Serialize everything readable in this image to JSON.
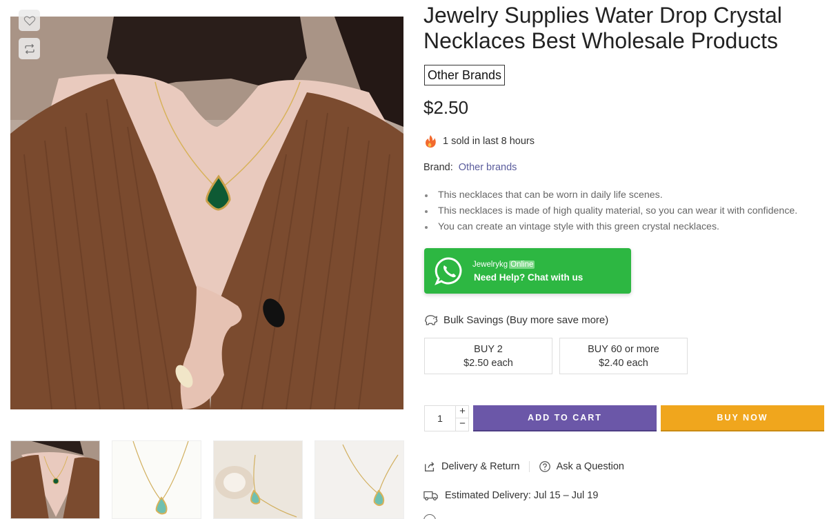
{
  "gallery": {
    "wishlist_icon": "heart-icon",
    "compare_icon": "compare-arrows-icon",
    "main_image_alt": "Model wearing green water drop crystal necklace with brown knit halter top",
    "thumbnails": [
      "thumb-1",
      "thumb-2",
      "thumb-3",
      "thumb-4"
    ]
  },
  "product": {
    "title": "Jewelry Supplies Water Drop Crystal Necklaces Best Wholesale Products",
    "brand_badge": "Other Brands",
    "price": "$2.50",
    "sold_text": "1 sold in last 8 hours",
    "brand_label": "Brand:",
    "brand_value": "Other brands",
    "features": [
      "This necklaces that can be worn in daily life scenes.",
      "This necklaces is made of high quality material, so you can wear it with confidence.",
      "You can create an vintage style with this green crystal necklaces."
    ]
  },
  "chat": {
    "name": "Jewelrykg",
    "status": "Online",
    "cta": "Need Help? Chat with us"
  },
  "bulk": {
    "heading": "Bulk Savings (Buy more save more)",
    "tiers": [
      {
        "qty": "BUY 2",
        "price": "$2.50 each"
      },
      {
        "qty": "BUY 60 or more",
        "price": "$2.40 each"
      }
    ]
  },
  "cart": {
    "quantity": "1",
    "plus": "+",
    "minus": "−",
    "add_to_cart": "ADD TO CART",
    "buy_now": "BUY NOW"
  },
  "links": {
    "delivery_return": "Delivery & Return",
    "ask_question": "Ask a Question",
    "estimated_delivery": "Estimated Delivery: Jul 15 – Jul 19"
  },
  "colors": {
    "accent_purple": "#6b57a8",
    "buy_now_orange": "#f0a61d",
    "whatsapp_green": "#2db742",
    "brand_link": "#5a5c9c"
  }
}
